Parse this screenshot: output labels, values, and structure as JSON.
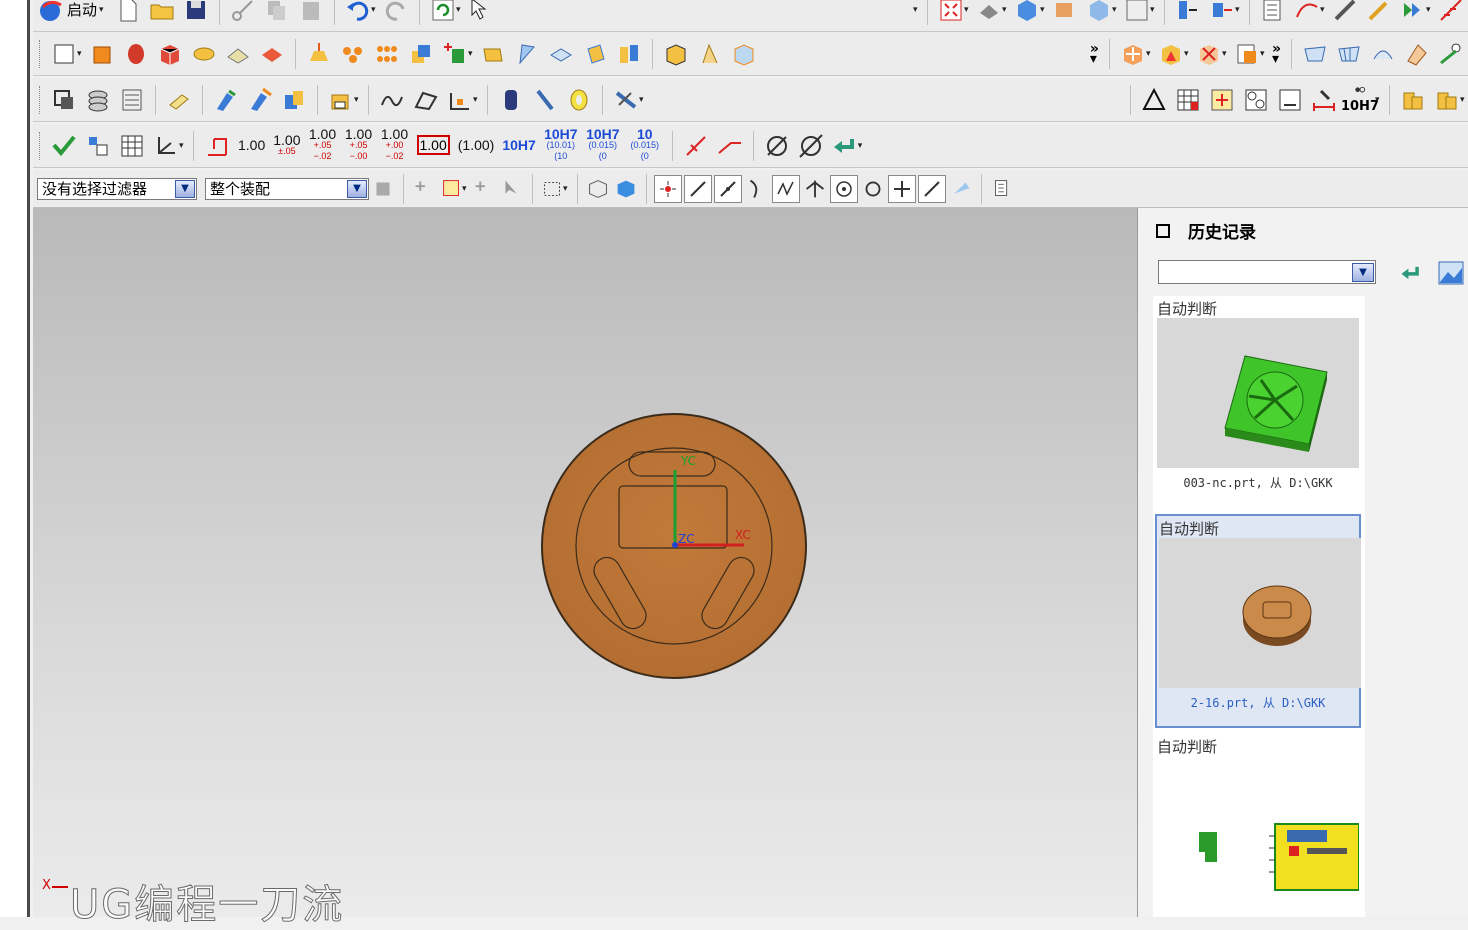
{
  "toolbar1": {
    "start_label": "启动"
  },
  "toolbar4": {
    "dims": [
      {
        "main": "1.00",
        "tol": ""
      },
      {
        "main": "1.00",
        "tol": "±.05"
      },
      {
        "main": "1.00",
        "tol": "+.05 −.02"
      },
      {
        "main": "1.00",
        "tol": "+.05 −.00"
      },
      {
        "main": "1.00",
        "tol": "+.00 −.02"
      }
    ],
    "boxed": "1.00",
    "paren": "(1.00)",
    "fit": "10H7",
    "fit_tol": [
      {
        "main": "10H7",
        "tol": "(10.01) (10"
      },
      {
        "main": "10H7",
        "tol": "(0.015) (0"
      },
      {
        "main": "10",
        "tol": "(0.015) (0"
      }
    ]
  },
  "toolbar3": {
    "fit_label": "10H7"
  },
  "selection": {
    "filter": "没有选择过滤器",
    "scope": "整个装配"
  },
  "viewport": {
    "axis_y": "YC",
    "axis_z": "ZC",
    "axis_x": "XC",
    "corner_axis": "X",
    "watermark": "UG编程一刀流",
    "part_color": "#c17a3a"
  },
  "history": {
    "title": "历史记录",
    "combo_value": "",
    "items": [
      {
        "label": "自动判断",
        "caption": "003-nc.prt, 从 D:\\GKK"
      },
      {
        "label": "自动判断",
        "caption": "2-16.prt, 从 D:\\GKK"
      },
      {
        "label": "自动判断",
        "caption": ""
      }
    ]
  }
}
